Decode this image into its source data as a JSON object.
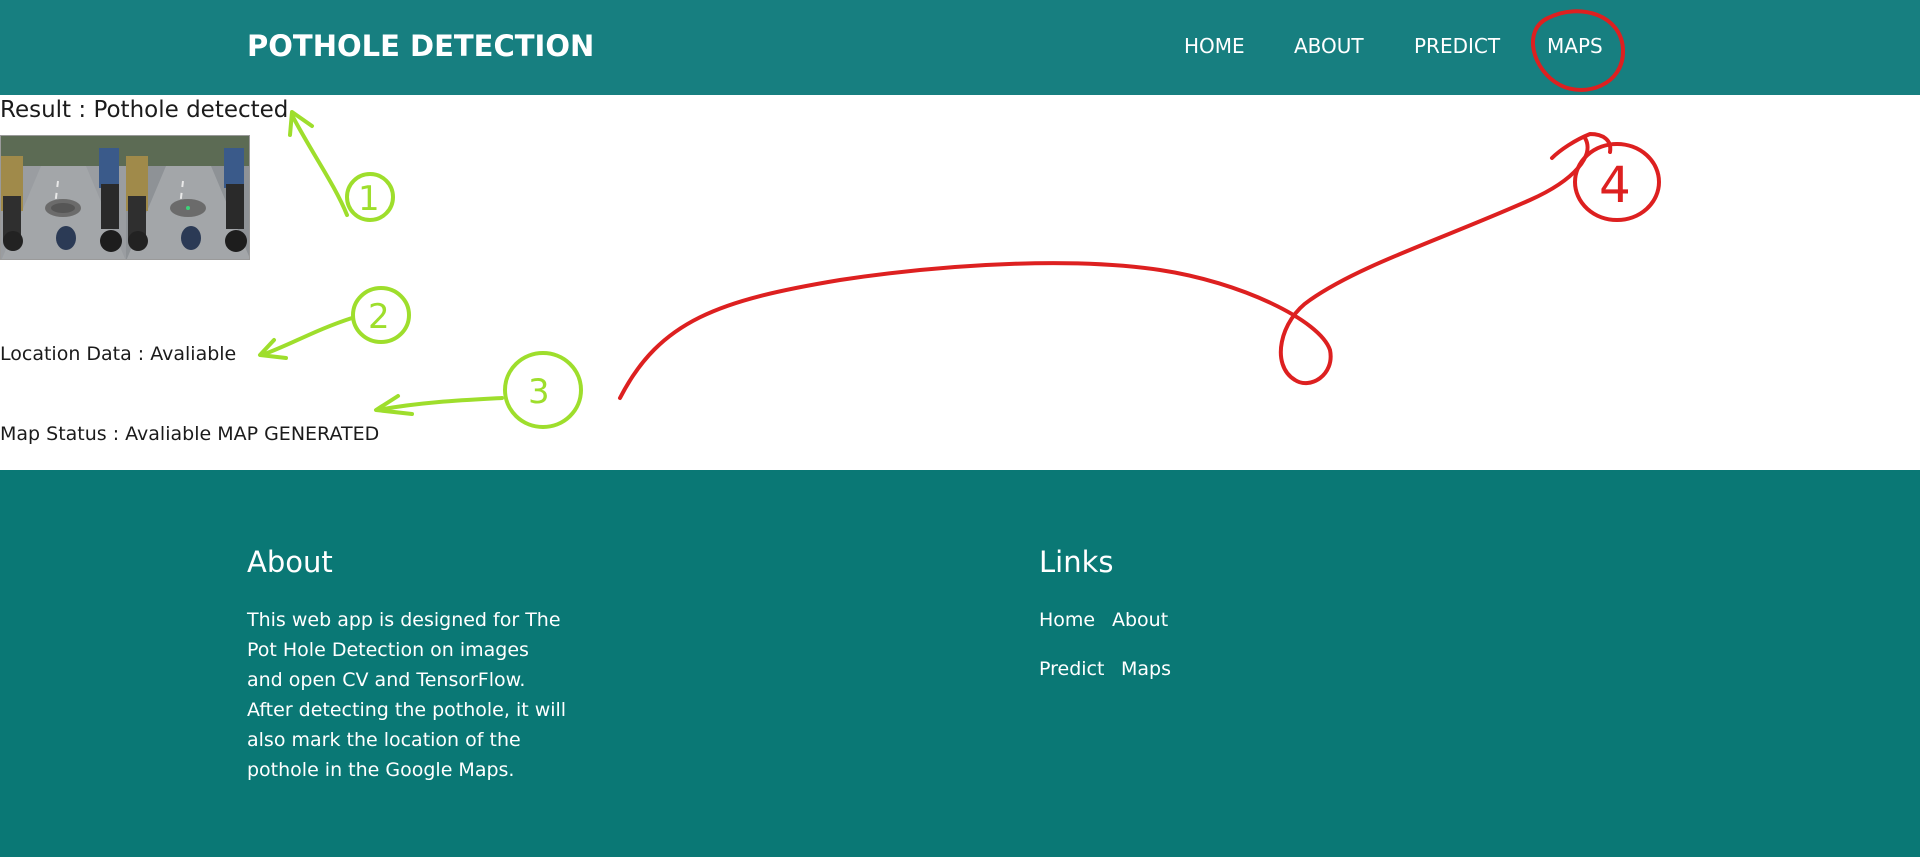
{
  "navbar": {
    "brand": "POTHOLE DETECTION",
    "links": [
      "HOME",
      "ABOUT",
      "PREDICT",
      "MAPS"
    ]
  },
  "main": {
    "result_label": "Result : Pothole detected",
    "location_label": "Location Data : Avaliable",
    "map_status_label": "Map Status : Avaliable MAP GENERATED"
  },
  "footer": {
    "about_heading": "About",
    "about_text": "This web app is designed for The Pot Hole Detection on images and open CV and TensorFlow. After detecting the pothole, it will also mark the location of the pothole in the Google Maps.",
    "links_heading": "Links",
    "links": [
      "Home",
      "About",
      "Predict",
      "Maps"
    ]
  },
  "annotations": {
    "green_labels": [
      "1",
      "2",
      "3"
    ],
    "red_label": "4",
    "green_color": "#9ede2c",
    "red_color": "#dd2020"
  },
  "colors": {
    "navbar_bg": "#177f80",
    "footer_bg": "#0a7875",
    "text_dark": "#1b1b1b",
    "text_light": "#ffffff"
  }
}
